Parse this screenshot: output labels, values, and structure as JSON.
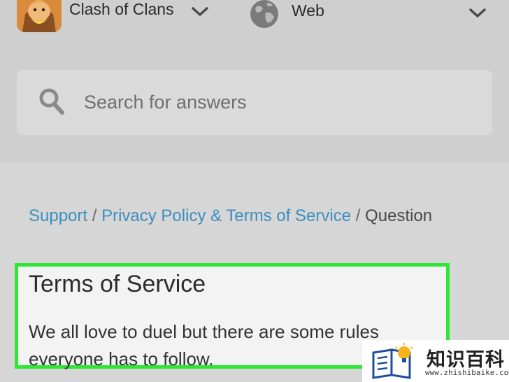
{
  "header": {
    "game_name": "Clash of Clans",
    "platform_name": "Web"
  },
  "search": {
    "placeholder": "Search for answers"
  },
  "breadcrumb": {
    "items": [
      "Support",
      "Privacy Policy & Terms of Service"
    ],
    "separator": "/",
    "current": "Question"
  },
  "article": {
    "title": "Terms of Service",
    "body": "We all love to duel but there are some rules everyone has to follow."
  },
  "watermark": {
    "name": "知识百科",
    "url": "www.zhishibaike.com"
  },
  "colors": {
    "link": "#3d8fc0",
    "highlight_border": "#2ee635"
  }
}
